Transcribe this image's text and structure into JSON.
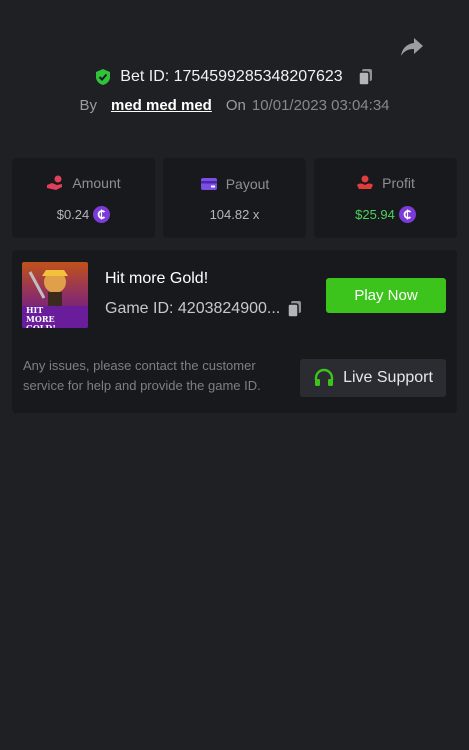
{
  "header": {
    "share_icon": "share-arrow-icon",
    "bet_id_label": "Bet ID: 1754599285348207623",
    "by_label": "By",
    "username": "med med med",
    "on_label": "On",
    "datetime": "10/01/2023 03:04:34"
  },
  "stats": {
    "amount": {
      "label": "Amount",
      "value": "$0.24",
      "icon": "hand-coin-icon"
    },
    "payout": {
      "label": "Payout",
      "value": "104.82 x",
      "icon": "wallet-card-icon"
    },
    "profit": {
      "label": "Profit",
      "value": "$25.94",
      "icon": "profit-hand-icon"
    }
  },
  "game": {
    "title": "Hit more Gold!",
    "game_id": "Game ID: 4203824900...",
    "thumb_text": "HIT MORE GOLD!",
    "play_label": "Play Now",
    "help_text": "Any issues, please contact the customer service for help and provide the game ID.",
    "support_label": "Live Support"
  },
  "colors": {
    "background": "#1f2024",
    "card": "#18191d",
    "accent_green": "#3cc31c",
    "profit_green": "#4bd35b",
    "coin_purple": "#7c3bd8",
    "amount_pink": "#e0405a",
    "payout_purple": "#7b4fe6",
    "profit_red": "#e23c3c"
  }
}
